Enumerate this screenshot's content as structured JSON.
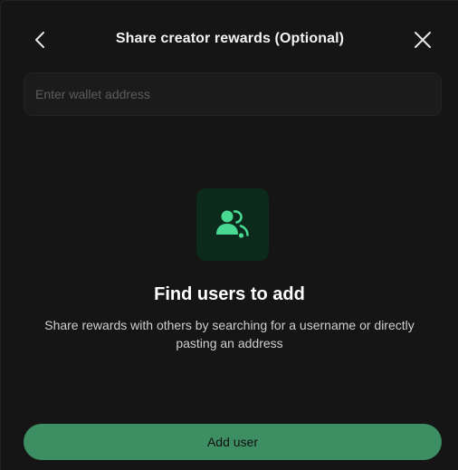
{
  "header": {
    "title": "Share creator rewards (Optional)",
    "back_icon": "chevron-left-icon",
    "close_icon": "close-icon"
  },
  "wallet_input": {
    "placeholder": "Enter wallet address",
    "value": ""
  },
  "empty_state": {
    "icon": "users-add-icon",
    "title": "Find users to add",
    "description": "Share rewards with others by searching for a username or directly pasting an address"
  },
  "actions": {
    "add_user_label": "Add user"
  },
  "colors": {
    "background": "#151515",
    "accent": "#3e8e63",
    "icon_bg": "#0c2a1c",
    "icon_fg": "#4ad992"
  }
}
